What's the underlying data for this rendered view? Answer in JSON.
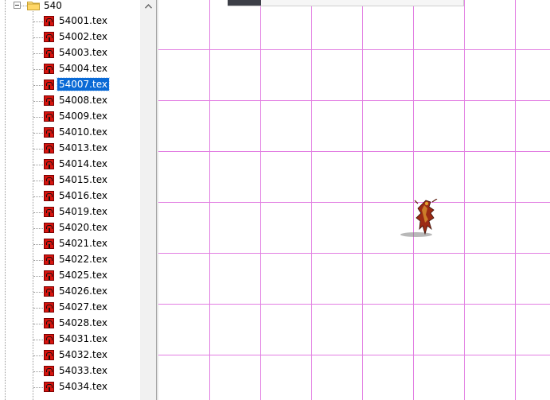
{
  "tree": {
    "folder": {
      "label": "540",
      "expanded": true
    },
    "files": [
      {
        "label": "54001.tex",
        "selected": false
      },
      {
        "label": "54002.tex",
        "selected": false
      },
      {
        "label": "54003.tex",
        "selected": false
      },
      {
        "label": "54004.tex",
        "selected": false
      },
      {
        "label": "54007.tex",
        "selected": true
      },
      {
        "label": "54008.tex",
        "selected": false
      },
      {
        "label": "54009.tex",
        "selected": false
      },
      {
        "label": "54010.tex",
        "selected": false
      },
      {
        "label": "54013.tex",
        "selected": false
      },
      {
        "label": "54014.tex",
        "selected": false
      },
      {
        "label": "54015.tex",
        "selected": false
      },
      {
        "label": "54016.tex",
        "selected": false
      },
      {
        "label": "54019.tex",
        "selected": false
      },
      {
        "label": "54020.tex",
        "selected": false
      },
      {
        "label": "54021.tex",
        "selected": false
      },
      {
        "label": "54022.tex",
        "selected": false
      },
      {
        "label": "54025.tex",
        "selected": false
      },
      {
        "label": "54026.tex",
        "selected": false
      },
      {
        "label": "54027.tex",
        "selected": false
      },
      {
        "label": "54028.tex",
        "selected": false
      },
      {
        "label": "54031.tex",
        "selected": false
      },
      {
        "label": "54032.tex",
        "selected": false
      },
      {
        "label": "54033.tex",
        "selected": false
      },
      {
        "label": "54034.tex",
        "selected": false
      }
    ],
    "file_icon": "tex-file-icon",
    "folder_icon": "folder-icon"
  },
  "scrollbar": {
    "up_arrow_icon": "chevron-up-icon"
  },
  "canvas": {
    "grid_color": "#e27ee2",
    "background": "#ffffff",
    "sprite_icon": "character-sprite"
  },
  "colors": {
    "selection": "#0a6ad6",
    "file_icon_red": "#d7140e"
  }
}
